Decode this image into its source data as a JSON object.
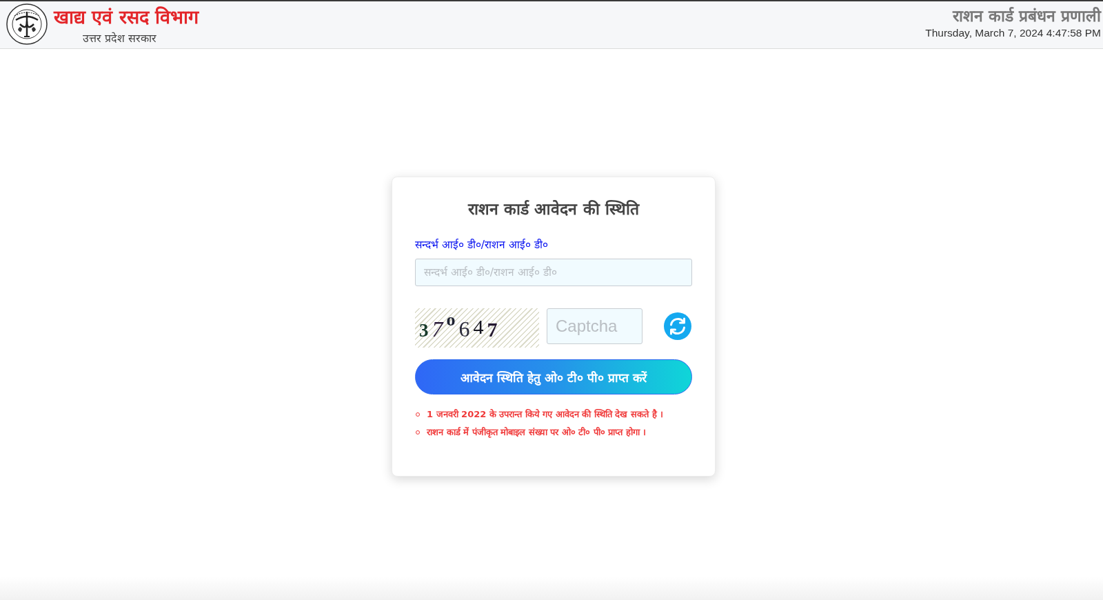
{
  "header": {
    "department": "खाद्य एवं रसद विभाग",
    "government": "उत्तर प्रदेश सरकार",
    "system_name": "राशन कार्ड प्रबंधन प्रणाली",
    "datetime": "Thursday, March 7, 2024 4:47:58 PM"
  },
  "form": {
    "title": "राशन कार्ड आवेदन की स्थिति",
    "id_field": {
      "label": "सन्दर्भ आई० डी०/राशन आई० डी०",
      "placeholder": "सन्दर्भ आई० डी०/राशन आई० डी०"
    },
    "captcha": {
      "code": "37$^{o}$647",
      "placeholder": "Captcha"
    },
    "submit": "आवेदन स्थिति हेतु ओ० टी० पी० प्राप्त करें",
    "notes": [
      "1 जनवरी 2022 के उपरान्त किये गए आवेदन की स्थिति देख सकते है ।",
      "राशन कार्ड में पंजीकृत मोबाइल संख्या पर ओ० टी० पी० प्राप्त होगा ।"
    ]
  }
}
